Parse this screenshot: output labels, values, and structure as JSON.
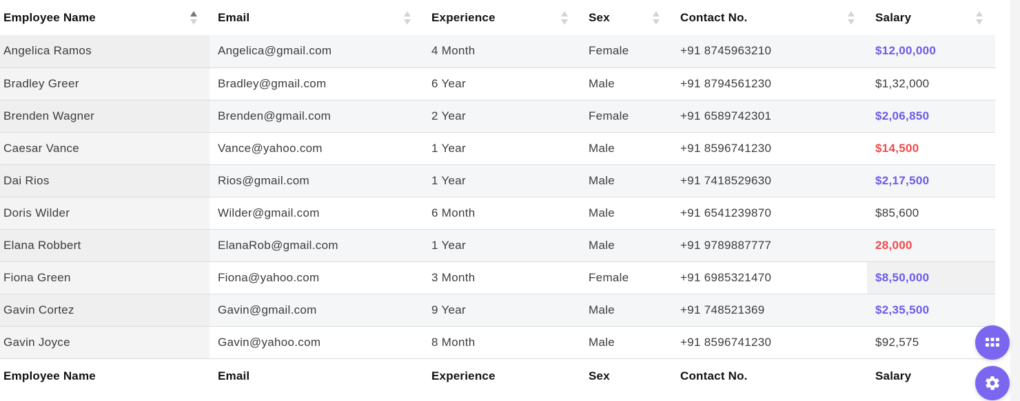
{
  "columns": [
    "Employee Name",
    "Email",
    "Experience",
    "Sex",
    "Contact No.",
    "Salary"
  ],
  "rows": [
    {
      "name": "Angelica Ramos",
      "email": "Angelica@gmail.com",
      "experience": "4 Month",
      "sex": "Female",
      "contact": "+91 8745963210",
      "salary": "$12,00,000",
      "salary_style": "purple"
    },
    {
      "name": "Bradley Greer",
      "email": "Bradley@gmail.com",
      "experience": "6 Year",
      "sex": "Male",
      "contact": "+91 8794561230",
      "salary": "$1,32,000",
      "salary_style": "normal"
    },
    {
      "name": "Brenden Wagner",
      "email": "Brenden@gmail.com",
      "experience": "2 Year",
      "sex": "Female",
      "contact": "+91 6589742301",
      "salary": "$2,06,850",
      "salary_style": "purple"
    },
    {
      "name": "Caesar Vance",
      "email": "Vance@yahoo.com",
      "experience": "1 Year",
      "sex": "Male",
      "contact": "+91 8596741230",
      "salary": "$14,500",
      "salary_style": "red"
    },
    {
      "name": "Dai Rios",
      "email": "Rios@gmail.com",
      "experience": "1 Year",
      "sex": "Male",
      "contact": "+91 7418529630",
      "salary": "$2,17,500",
      "salary_style": "purple"
    },
    {
      "name": "Doris Wilder",
      "email": "Wilder@gmail.com",
      "experience": "6 Month",
      "sex": "Male",
      "contact": "+91 6541239870",
      "salary": "$85,600",
      "salary_style": "normal"
    },
    {
      "name": "Elana Robbert",
      "email": "ElanaRob@gmail.com",
      "experience": "1 Year",
      "sex": "Male",
      "contact": "+91 9789887777",
      "salary": "28,000",
      "salary_style": "red"
    },
    {
      "name": "Fiona Green",
      "email": "Fiona@yahoo.com",
      "experience": "3 Month",
      "sex": "Female",
      "contact": "+91 6985321470",
      "salary": "$8,50,000",
      "salary_style": "purple"
    },
    {
      "name": "Gavin Cortez",
      "email": "Gavin@gmail.com",
      "experience": "9 Year",
      "sex": "Male",
      "contact": "+91 748521369",
      "salary": "$2,35,500",
      "salary_style": "purple"
    },
    {
      "name": "Gavin Joyce",
      "email": "Gavin@yahoo.com",
      "experience": "8 Month",
      "sex": "Male",
      "contact": "+91 8596741230",
      "salary": "$92,575",
      "salary_style": "normal"
    }
  ],
  "icons": {
    "apps": "apps-grid-icon",
    "settings": "gear-icon",
    "sort": "sort-arrows-icon"
  },
  "colors": {
    "accent": "#7b66ef",
    "salary_purple": "#6b5ce7",
    "salary_red": "#ef4a4a"
  }
}
